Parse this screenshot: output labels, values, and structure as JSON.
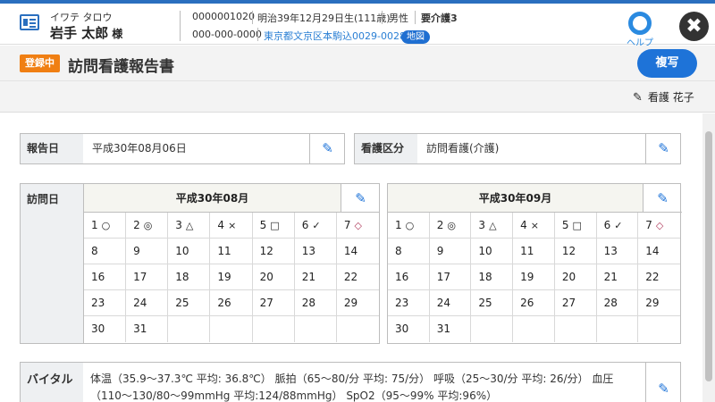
{
  "patient": {
    "kana": "イワテ タロウ",
    "name": "岩手 太郎",
    "honorific": "様",
    "id": "0000001020",
    "birth": "明治39年12月29日生(111歳)",
    "sex": "男性",
    "care_level": "要介護3",
    "phone": "000-000-0000",
    "address": "東京都文京区本駒込0029-0028",
    "map_label": "地図"
  },
  "header": {
    "help_label": "ヘルプ",
    "close_glyph": "✖"
  },
  "titlebar": {
    "status_badge": "登録中",
    "title": "訪問看護報告書",
    "copy_label": "複写"
  },
  "author": {
    "name": "看護 花子"
  },
  "report": {
    "date_label": "報告日",
    "date_value": "平成30年08月06日",
    "type_label": "看護区分",
    "type_value": "訪問看護(介護)",
    "visit_label": "訪問日"
  },
  "calendars": [
    {
      "month": "平成30年08月",
      "days": [
        {
          "d": "1",
          "m": "○"
        },
        {
          "d": "2",
          "m": "◎"
        },
        {
          "d": "3",
          "m": "△"
        },
        {
          "d": "4",
          "m": "×"
        },
        {
          "d": "5",
          "m": "□"
        },
        {
          "d": "6",
          "m": "✓"
        },
        {
          "d": "7",
          "m": "◇"
        },
        {
          "d": "8",
          "m": ""
        },
        {
          "d": "9",
          "m": ""
        },
        {
          "d": "10",
          "m": ""
        },
        {
          "d": "11",
          "m": ""
        },
        {
          "d": "12",
          "m": ""
        },
        {
          "d": "13",
          "m": ""
        },
        {
          "d": "14",
          "m": ""
        },
        {
          "d": "16",
          "m": ""
        },
        {
          "d": "17",
          "m": ""
        },
        {
          "d": "18",
          "m": ""
        },
        {
          "d": "19",
          "m": ""
        },
        {
          "d": "20",
          "m": ""
        },
        {
          "d": "21",
          "m": ""
        },
        {
          "d": "22",
          "m": ""
        },
        {
          "d": "23",
          "m": ""
        },
        {
          "d": "24",
          "m": ""
        },
        {
          "d": "25",
          "m": ""
        },
        {
          "d": "26",
          "m": ""
        },
        {
          "d": "27",
          "m": ""
        },
        {
          "d": "28",
          "m": ""
        },
        {
          "d": "29",
          "m": ""
        },
        {
          "d": "30",
          "m": ""
        },
        {
          "d": "31",
          "m": ""
        },
        {
          "d": "",
          "m": ""
        },
        {
          "d": "",
          "m": ""
        },
        {
          "d": "",
          "m": ""
        },
        {
          "d": "",
          "m": ""
        },
        {
          "d": "",
          "m": ""
        }
      ]
    },
    {
      "month": "平成30年09月",
      "days": [
        {
          "d": "1",
          "m": "○"
        },
        {
          "d": "2",
          "m": "◎"
        },
        {
          "d": "3",
          "m": "△"
        },
        {
          "d": "4",
          "m": "×"
        },
        {
          "d": "5",
          "m": "□"
        },
        {
          "d": "6",
          "m": "✓"
        },
        {
          "d": "7",
          "m": "◇"
        },
        {
          "d": "8",
          "m": ""
        },
        {
          "d": "9",
          "m": ""
        },
        {
          "d": "10",
          "m": ""
        },
        {
          "d": "11",
          "m": ""
        },
        {
          "d": "12",
          "m": ""
        },
        {
          "d": "13",
          "m": ""
        },
        {
          "d": "14",
          "m": ""
        },
        {
          "d": "16",
          "m": ""
        },
        {
          "d": "17",
          "m": ""
        },
        {
          "d": "18",
          "m": ""
        },
        {
          "d": "19",
          "m": ""
        },
        {
          "d": "20",
          "m": ""
        },
        {
          "d": "21",
          "m": ""
        },
        {
          "d": "22",
          "m": ""
        },
        {
          "d": "23",
          "m": ""
        },
        {
          "d": "24",
          "m": ""
        },
        {
          "d": "25",
          "m": ""
        },
        {
          "d": "26",
          "m": ""
        },
        {
          "d": "27",
          "m": ""
        },
        {
          "d": "28",
          "m": ""
        },
        {
          "d": "29",
          "m": ""
        },
        {
          "d": "30",
          "m": ""
        },
        {
          "d": "31",
          "m": ""
        },
        {
          "d": "",
          "m": ""
        },
        {
          "d": "",
          "m": ""
        },
        {
          "d": "",
          "m": ""
        },
        {
          "d": "",
          "m": ""
        },
        {
          "d": "",
          "m": ""
        }
      ]
    }
  ],
  "vital": {
    "label": "バイタル",
    "text": "体温（35.9〜37.3℃ 平均: 36.8℃） 脈拍（65〜80/分 平均: 75/分） 呼吸（25〜30/分 平均: 26/分） 血圧（110〜130/80〜99mmHg 平均:124/88mmHg） SpO2（95〜99% 平均:96%）"
  },
  "icons": {
    "pencil": "✎"
  },
  "colors": {
    "accent": "#1e73d8",
    "badge": "#f07f13",
    "header_strip": "#2a6fbf",
    "label_bg": "#eef0f2"
  }
}
